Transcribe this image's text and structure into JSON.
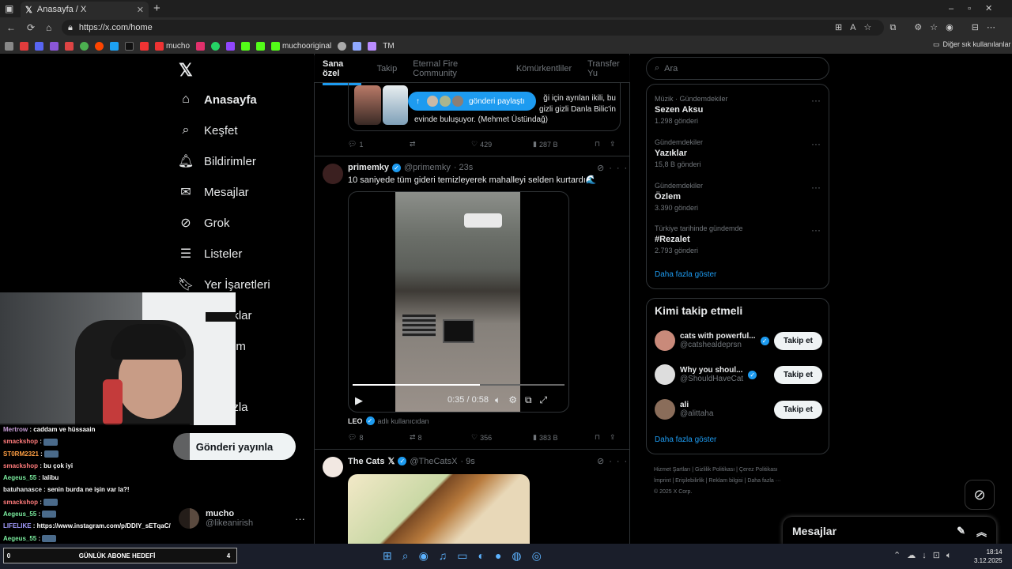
{
  "browser": {
    "tab_title": "Anasayfa / X",
    "url": "https://x.com/home",
    "bookmarks": [
      "mucho",
      "muchooriginal",
      "TM"
    ],
    "other_bookmarks": "Diğer sık kullanılanlar"
  },
  "nav": {
    "items": [
      {
        "label": "Anasayfa",
        "icon": "home-icon"
      },
      {
        "label": "Keşfet",
        "icon": "search-icon"
      },
      {
        "label": "Bildirimler",
        "icon": "bell-icon"
      },
      {
        "label": "Mesajlar",
        "icon": "mail-icon"
      },
      {
        "label": "Grok",
        "icon": "grok-icon"
      },
      {
        "label": "Listeler",
        "icon": "list-icon"
      },
      {
        "label": "Yer İşaretleri",
        "icon": "bookmark-icon"
      },
      {
        "label": "uklar",
        "icon": "community-icon"
      },
      {
        "label": "um",
        "icon": "premium-icon"
      },
      {
        "label": "azla",
        "icon": "more-icon"
      }
    ],
    "post_button": "Gönderi yayınla",
    "account": {
      "name": "mucho",
      "handle": "@likeanirish"
    }
  },
  "feed": {
    "tabs": [
      "Sana özel",
      "Takip",
      "Eternal Fire Community",
      "Kömürkentliler",
      "Transfer Yu"
    ],
    "share_pill": "gönderi paylaştı",
    "post0": {
      "text_line1": "ği için ayrılan ikili, bu",
      "text_line2": "gizli gizli Danla Bilic'in",
      "text_line3": "evinde buluşuyor. (Mehmet Üstündağ)",
      "replies": "1",
      "reposts": "",
      "likes": "429",
      "views": "287 B"
    },
    "post1": {
      "name": "primemky",
      "handle": "@primemky",
      "time": "· 23s",
      "text": "10 saniyede tüm gideri temizleyerek mahalleyi selden kurtardı🌊",
      "video_time": "0:35 / 0:58",
      "video_progress": 0.6,
      "source_name": "LEO",
      "source_suffix": "adlı kullanıcıdan",
      "replies": "8",
      "reposts": "8",
      "likes": "356",
      "views": "383 B"
    },
    "post2": {
      "name": "The Cats",
      "handle": "@TheCatsX",
      "time": "· 9s"
    }
  },
  "right": {
    "search_placeholder": "Ara",
    "trends": [
      {
        "category": "Müzik · Gündemdekiler",
        "title": "Sezen Aksu",
        "count": "1.298 gönderi"
      },
      {
        "category": "Gündemdekiler",
        "title": "Yazıklar",
        "count": "15,8 B gönderi"
      },
      {
        "category": "Gündemdekiler",
        "title": "Özlem",
        "count": "3.390 gönderi"
      },
      {
        "category": "Türkiye tarihinde gündemde",
        "title": "#Rezalet",
        "count": "2.793 gönderi"
      }
    ],
    "trends_more": "Daha fazla göster",
    "who_title": "Kimi takip etmeli",
    "who": [
      {
        "name": "cats with powerful...",
        "handle": "@catshealdeprsn",
        "button": "Takip et",
        "color": "#c98a7a"
      },
      {
        "name": "Why you shoul...",
        "handle": "@ShouldHaveCat",
        "button": "Takip et",
        "color": "#ddd"
      },
      {
        "name": "ali",
        "handle": "@alittaha",
        "button": "Takip et",
        "color": "#8a6d5a"
      }
    ],
    "who_more": "Daha fazla göster",
    "footer": [
      "Hizmet Şartları",
      "Gizlilik Politikası",
      "Çerez Politikası",
      "İmprint",
      "Erişilebilirlik",
      "Reklam bilgisi",
      "Daha fazla ···",
      "© 2025 X Corp."
    ]
  },
  "dm": {
    "title": "Mesajlar"
  },
  "stream": {
    "chat": [
      {
        "user": "Mertrow",
        "msg": "caddam ve hüssaain",
        "color": "#c39bd3"
      },
      {
        "user": "smackshop",
        "msg": "",
        "color": "#ff7b7b"
      },
      {
        "user": "ST0RM2321",
        "msg": "",
        "color": "#ff9f43"
      },
      {
        "user": "smackshop",
        "msg": "bu çok iyi",
        "color": "#ff7b7b"
      },
      {
        "user": "Aegeus_55",
        "msg": "lalibu",
        "color": "#7bed9f"
      },
      {
        "user": "batuhanasce",
        "msg": "senin burda ne işin var la?!",
        "color": "#e7e9ea"
      },
      {
        "user": "smackshop",
        "msg": "",
        "color": "#ff7b7b"
      },
      {
        "user": "Aegeus_55",
        "msg": "",
        "color": "#7bed9f"
      },
      {
        "user": "LIFELIKE",
        "msg": "https://www.instagram.com/p/DDIY_sETqaC/",
        "color": "#a29bfe"
      },
      {
        "user": "Aegeus_55",
        "msg": "",
        "color": "#7bed9f"
      }
    ],
    "goal_label": "GÜNLÜK ABONE HEDEFİ",
    "goal_left": "0",
    "goal_right": "4"
  },
  "taskbar": {
    "time": "18:14",
    "date": "3.12.2025"
  }
}
